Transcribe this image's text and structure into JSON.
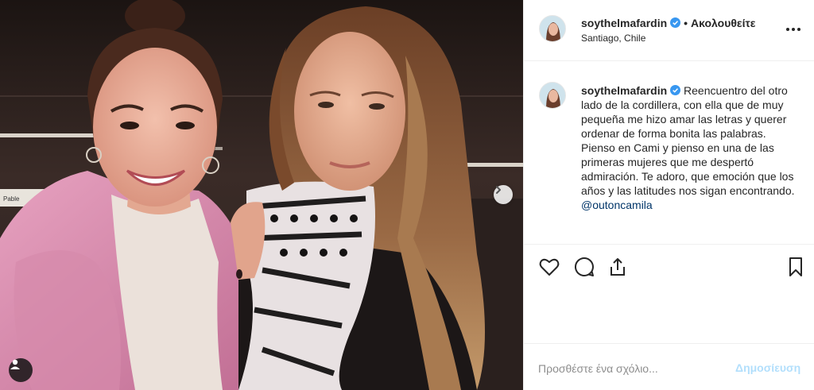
{
  "post": {
    "username": "soythelmafardin",
    "follow_status": "Ακολουθείτε",
    "location": "Santiago, Chile",
    "separator": "•",
    "photo": {
      "sign_text": "Pable",
      "description_icon": "photo-content"
    }
  },
  "caption": {
    "username": "soythelmafardin",
    "text": "Reencuentro del otro lado de la cordillera, con ella que de muy pequeña me hizo amar las letras y querer ordenar de forma bonita las palabras. Pienso en Cami y pienso en una de las primeras mujeres que me despertó admiración. Te adoro, que emoción que los años y las latitudes nos sigan encontrando.",
    "mention": "@outoncamila"
  },
  "actions": {
    "icons": [
      "heart-icon",
      "comment-icon",
      "share-icon",
      "bookmark-icon"
    ]
  },
  "comment": {
    "placeholder": "Προσθέστε ένα σχόλιο...",
    "post_label": "Δημοσίευση"
  },
  "colors": {
    "verified_blue": "#3897f0",
    "link_blue": "#003569",
    "post_button_disabled": "#b2dffc",
    "border": "#efefef",
    "text": "#262626"
  }
}
